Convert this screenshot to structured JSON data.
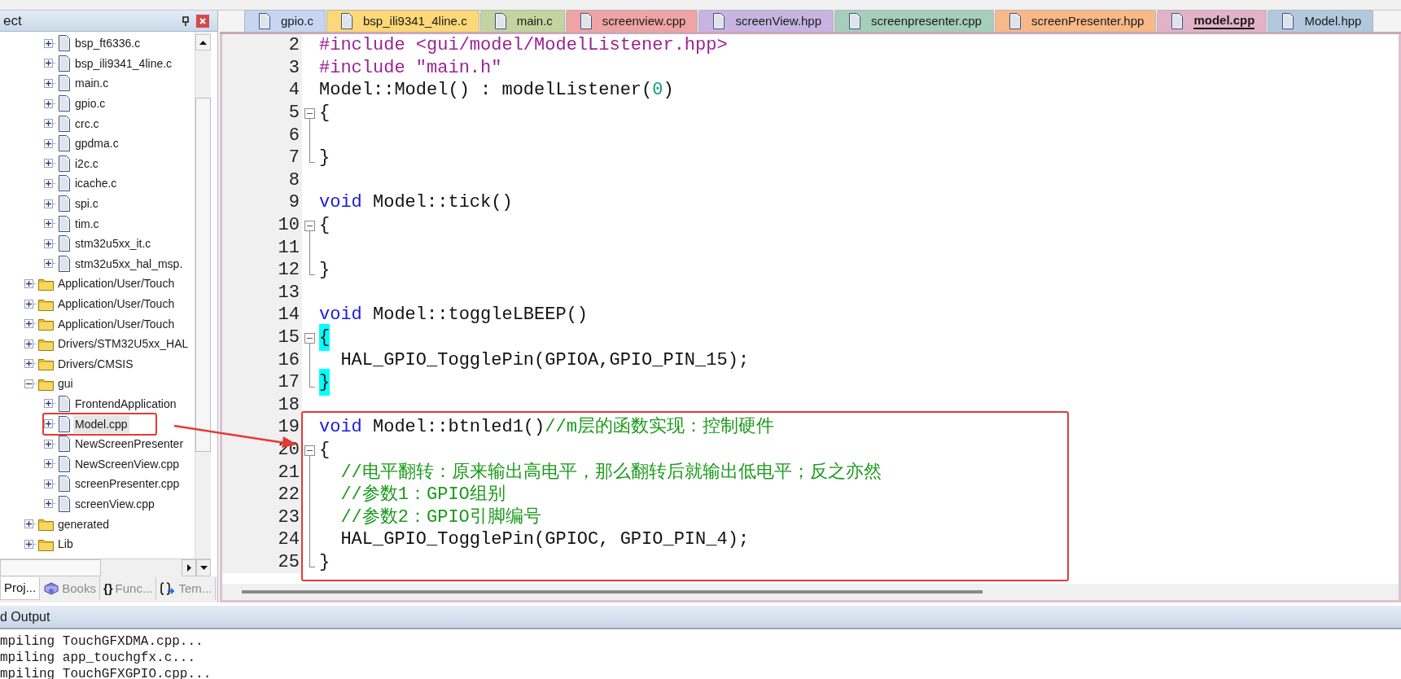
{
  "sidebar": {
    "title": "ect",
    "tree": [
      {
        "children": [
          {
            "label": "bsp_ft6336.c",
            "kind": "file",
            "expanded": false,
            "selected": false
          },
          {
            "label": "bsp_ili9341_4line.c",
            "kind": "file",
            "expanded": false,
            "selected": false
          },
          {
            "label": "main.c",
            "kind": "file",
            "expanded": false,
            "selected": false
          },
          {
            "label": "gpio.c",
            "kind": "file",
            "expanded": false,
            "selected": false
          },
          {
            "label": "crc.c",
            "kind": "file",
            "expanded": false,
            "selected": false
          },
          {
            "label": "gpdma.c",
            "kind": "file",
            "expanded": false,
            "selected": false
          },
          {
            "label": "i2c.c",
            "kind": "file",
            "expanded": false,
            "selected": false
          },
          {
            "label": "icache.c",
            "kind": "file",
            "expanded": false,
            "selected": false
          },
          {
            "label": "spi.c",
            "kind": "file",
            "expanded": false,
            "selected": false
          },
          {
            "label": "tim.c",
            "kind": "file",
            "expanded": false,
            "selected": false
          },
          {
            "label": "stm32u5xx_it.c",
            "kind": "file",
            "expanded": false,
            "selected": false
          },
          {
            "label": "stm32u5xx_hal_msp.",
            "kind": "file",
            "expanded": false,
            "selected": false
          }
        ]
      },
      {
        "label": "Application/User/Touch",
        "kind": "folder",
        "expanded": false,
        "selected": false
      },
      {
        "label": "Application/User/Touch",
        "kind": "folder",
        "expanded": false,
        "selected": false
      },
      {
        "label": "Application/User/Touch",
        "kind": "folder",
        "expanded": false,
        "selected": false
      },
      {
        "label": "Drivers/STM32U5xx_HAL",
        "kind": "folder",
        "expanded": false,
        "selected": false
      },
      {
        "label": "Drivers/CMSIS",
        "kind": "folder",
        "expanded": false,
        "selected": false
      },
      {
        "label": "gui",
        "kind": "folder",
        "expanded": true,
        "selected": false,
        "children": [
          {
            "label": "FrontendApplication",
            "kind": "file",
            "expanded": false,
            "selected": false
          },
          {
            "label": "Model.cpp",
            "kind": "file",
            "expanded": false,
            "selected": true
          },
          {
            "label": "NewScreenPresenter",
            "kind": "file",
            "expanded": false,
            "selected": false
          },
          {
            "label": "NewScreenView.cpp",
            "kind": "file",
            "expanded": false,
            "selected": false
          },
          {
            "label": "screenPresenter.cpp",
            "kind": "file",
            "expanded": false,
            "selected": false
          },
          {
            "label": "screenView.cpp",
            "kind": "file",
            "expanded": false,
            "selected": false
          }
        ]
      },
      {
        "label": "generated",
        "kind": "folder",
        "expanded": false,
        "selected": false
      },
      {
        "label": "Lib",
        "kind": "folder",
        "expanded": false,
        "selected": false
      }
    ],
    "tabs": [
      {
        "kind": "project",
        "label": "Proj...",
        "selected": true
      },
      {
        "kind": "books",
        "label": "Books",
        "selected": false
      },
      {
        "kind": "functions",
        "glyph": "{}",
        "label": "Func...",
        "selected": false
      },
      {
        "kind": "templates",
        "label": "Tem...",
        "selected": false
      }
    ]
  },
  "editor": {
    "tabs": [
      {
        "label": "gpio.c",
        "color": "#c6d6f2",
        "selected": false
      },
      {
        "label": "bsp_ili9341_4line.c",
        "color": "#fcd878",
        "selected": false
      },
      {
        "label": "main.c",
        "color": "#c4d4a0",
        "selected": false
      },
      {
        "label": "screenview.cpp",
        "color": "#eea4a4",
        "selected": false
      },
      {
        "label": "screenView.hpp",
        "color": "#c8b4e2",
        "selected": false
      },
      {
        "label": "screenpresenter.cpp",
        "color": "#a6ceba",
        "selected": false
      },
      {
        "label": "screenPresenter.hpp",
        "color": "#f8b888",
        "selected": false
      },
      {
        "label": "model.cpp",
        "color": "#e2b2c8",
        "selected": true
      },
      {
        "label": "Model.hpp",
        "color": "#b2c8de",
        "selected": false
      }
    ],
    "lines": [
      {
        "number": "2",
        "fold_start": false,
        "in_fold": false,
        "fold_end": false,
        "tokens": [
          {
            "text": "#include <gui/model/ModelListener.hpp>",
            "kind": "preproc"
          }
        ]
      },
      {
        "number": "3",
        "fold_start": false,
        "in_fold": false,
        "fold_end": false,
        "tokens": [
          {
            "text": "#include \"main.h\"",
            "kind": "preproc"
          }
        ]
      },
      {
        "number": "4",
        "fold_start": false,
        "in_fold": false,
        "fold_end": false,
        "tokens": [
          {
            "text": "Model::Model() : modelListener(",
            "kind": "plain"
          },
          {
            "text": "0",
            "kind": "number"
          },
          {
            "text": ")",
            "kind": "plain"
          }
        ]
      },
      {
        "number": "5",
        "fold_start": true,
        "in_fold": false,
        "fold_end": false,
        "tokens": [
          {
            "text": "{",
            "kind": "plain"
          }
        ]
      },
      {
        "number": "6",
        "fold_start": false,
        "in_fold": true,
        "fold_end": false
      },
      {
        "number": "7",
        "fold_start": false,
        "in_fold": false,
        "fold_end": true,
        "tokens": [
          {
            "text": "}",
            "kind": "plain"
          }
        ]
      },
      {
        "number": "8",
        "fold_start": false,
        "in_fold": false,
        "fold_end": false
      },
      {
        "number": "9",
        "fold_start": false,
        "in_fold": false,
        "fold_end": false,
        "tokens": [
          {
            "text": "void",
            "kind": "keyword"
          },
          {
            "text": " Model::tick()",
            "kind": "plain"
          }
        ]
      },
      {
        "number": "10",
        "fold_start": true,
        "in_fold": false,
        "fold_end": false,
        "tokens": [
          {
            "text": "{",
            "kind": "plain"
          }
        ]
      },
      {
        "number": "11",
        "fold_start": false,
        "in_fold": true,
        "fold_end": false
      },
      {
        "number": "12",
        "fold_start": false,
        "in_fold": false,
        "fold_end": true,
        "tokens": [
          {
            "text": "}",
            "kind": "plain"
          }
        ]
      },
      {
        "number": "13",
        "fold_start": false,
        "in_fold": false,
        "fold_end": false
      },
      {
        "number": "14",
        "fold_start": false,
        "in_fold": false,
        "fold_end": false,
        "tokens": [
          {
            "text": "void",
            "kind": "keyword"
          },
          {
            "text": " Model::toggleLBEEP()",
            "kind": "plain"
          }
        ]
      },
      {
        "number": "15",
        "fold_start": true,
        "in_fold": false,
        "fold_end": false,
        "tokens": [
          {
            "text": "{",
            "kind": "brace_match"
          }
        ]
      },
      {
        "number": "16",
        "fold_start": false,
        "in_fold": true,
        "fold_end": false,
        "tokens": [
          {
            "text": "  HAL_GPIO_TogglePin(GPIOA,GPIO_PIN_15);",
            "kind": "plain"
          }
        ]
      },
      {
        "number": "17",
        "fold_start": false,
        "in_fold": false,
        "fold_end": true,
        "tokens": [
          {
            "text": "}",
            "kind": "brace_match"
          }
        ]
      },
      {
        "number": "18",
        "fold_start": false,
        "in_fold": false,
        "fold_end": false
      },
      {
        "number": "19",
        "fold_start": false,
        "in_fold": false,
        "fold_end": false,
        "tokens": [
          {
            "text": "void",
            "kind": "keyword"
          },
          {
            "text": " Model::btnled1()",
            "kind": "plain"
          },
          {
            "text": "//m层的函数实现：控制硬件",
            "kind": "comment"
          }
        ]
      },
      {
        "number": "20",
        "fold_start": true,
        "in_fold": false,
        "fold_end": false,
        "tokens": [
          {
            "text": "{",
            "kind": "plain"
          }
        ]
      },
      {
        "number": "21",
        "fold_start": false,
        "in_fold": true,
        "fold_end": false,
        "tokens": [
          {
            "text": "  //电平翻转：原来输出高电平，那么翻转后就输出低电平；反之亦然",
            "kind": "comment"
          }
        ]
      },
      {
        "number": "22",
        "fold_start": false,
        "in_fold": true,
        "fold_end": false,
        "tokens": [
          {
            "text": "  //参数1：GPIO组别",
            "kind": "comment"
          }
        ]
      },
      {
        "number": "23",
        "fold_start": false,
        "in_fold": true,
        "fold_end": false,
        "tokens": [
          {
            "text": "  //参数2：GPIO引脚编号",
            "kind": "comment"
          }
        ]
      },
      {
        "number": "24",
        "fold_start": false,
        "in_fold": true,
        "fold_end": false,
        "tokens": [
          {
            "text": "  HAL_GPIO_TogglePin(GPIOC, GPIO_PIN_4);",
            "kind": "plain"
          }
        ]
      },
      {
        "number": "25",
        "fold_start": false,
        "in_fold": false,
        "fold_end": true,
        "tokens": [
          {
            "text": "}",
            "kind": "plain"
          }
        ]
      }
    ]
  },
  "output": {
    "title": "d Output",
    "lines": [
      "mpiling TouchGFXDMA.cpp...",
      "mpiling app_touchgfx.c...",
      "mpiling TouchGFXGPIO.cpp..."
    ]
  }
}
